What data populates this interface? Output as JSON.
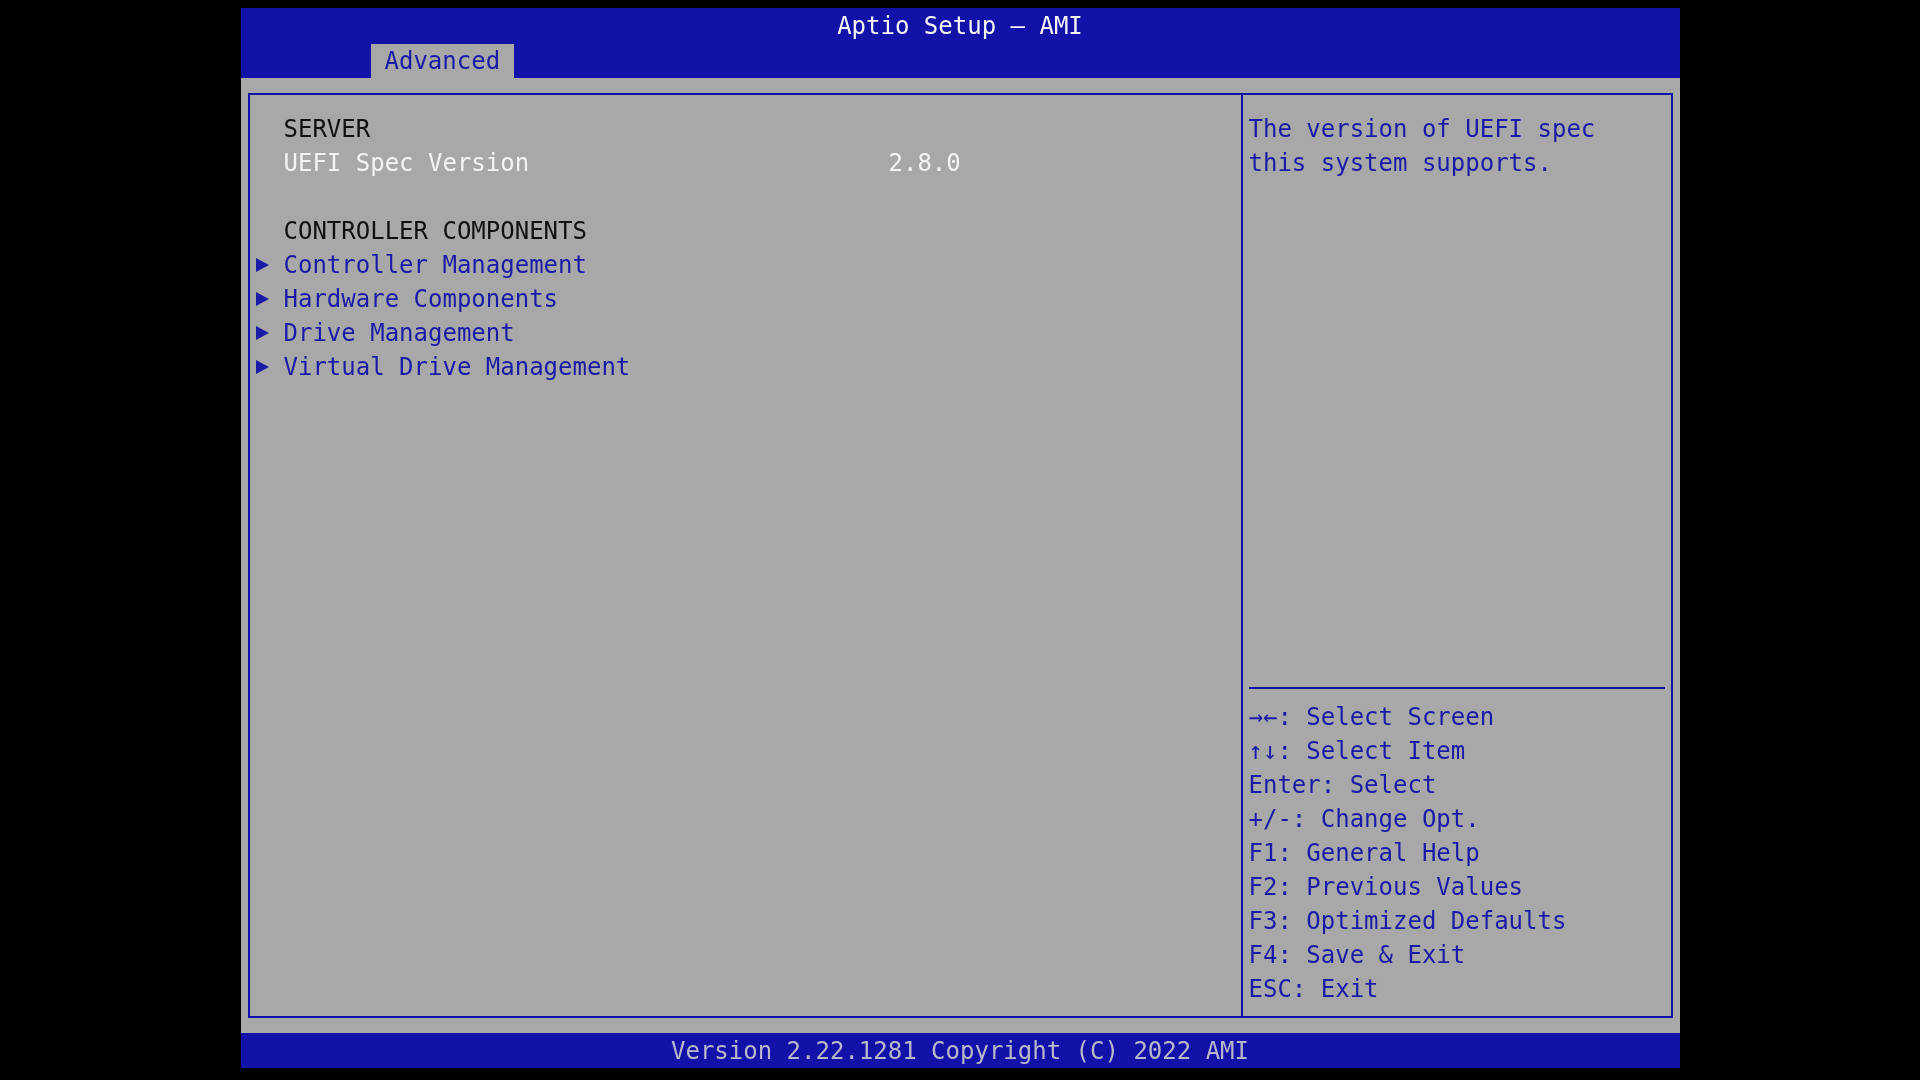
{
  "window": {
    "title": "Aptio Setup – AMI"
  },
  "tabs": [
    {
      "label": "Advanced",
      "selected": true
    }
  ],
  "sections": [
    {
      "title": "SERVER",
      "items": [
        {
          "kind": "info",
          "label": "UEFI Spec Version",
          "value": "2.8.0"
        }
      ]
    },
    {
      "title": "CONTROLLER COMPONENTS",
      "items": [
        {
          "kind": "submenu",
          "label": "Controller Management"
        },
        {
          "kind": "submenu",
          "label": "Hardware Components"
        },
        {
          "kind": "submenu",
          "label": "Drive Management"
        },
        {
          "kind": "submenu",
          "label": "Virtual Drive Management"
        }
      ]
    }
  ],
  "help": {
    "text": "The version of UEFI spec this system supports."
  },
  "keys": [
    "→←: Select Screen",
    "↑↓: Select Item",
    "Enter: Select",
    "+/-: Change Opt.",
    "F1: General Help",
    "F2: Previous Values",
    "F3: Optimized Defaults",
    "F4: Save & Exit",
    "ESC: Exit"
  ],
  "status_bar": "Version 2.22.1281 Copyright (C) 2022 AMI"
}
